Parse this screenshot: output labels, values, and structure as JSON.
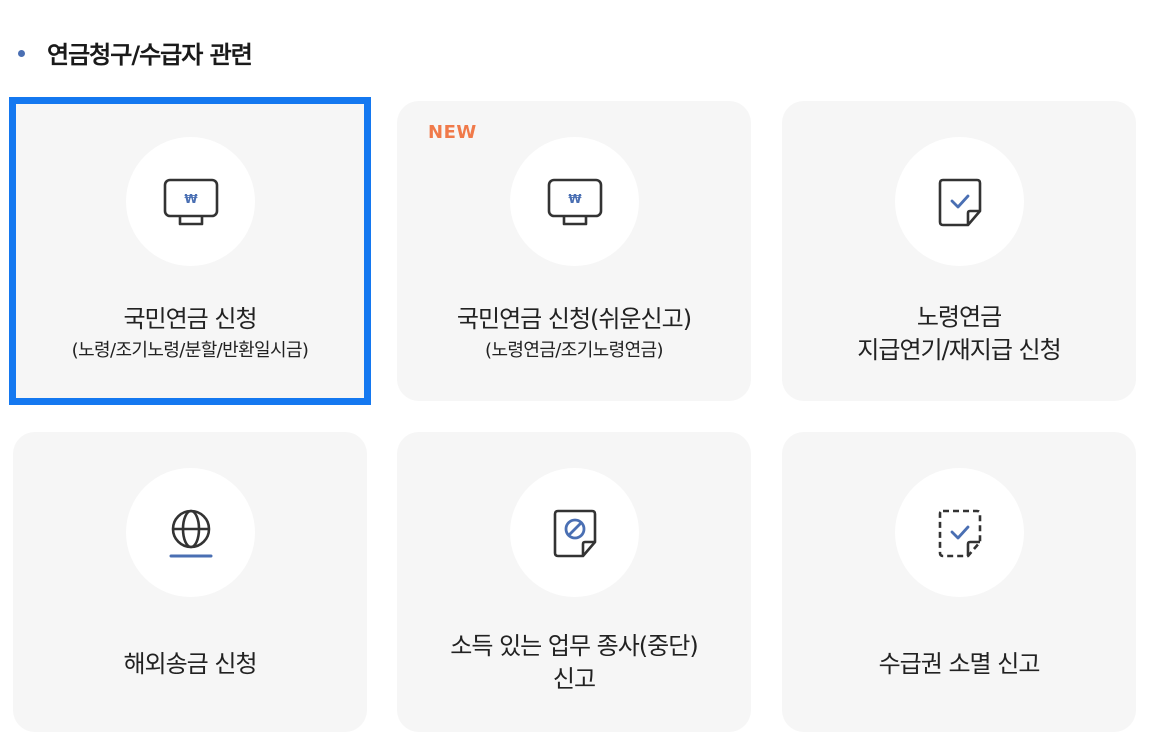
{
  "section": {
    "title": "연금청구/수급자 관련"
  },
  "colors": {
    "accent_blue": "#1478f0",
    "bullet": "#4a6fb3",
    "icon_blue": "#4a6fb3",
    "new_badge": "#f07a4a",
    "card_bg": "#f6f6f6"
  },
  "cards": [
    {
      "icon": "monitor-won-icon",
      "title": "국민연금 신청",
      "subtitle": "(노령/조기노령/분할/반환일시금)",
      "selected": true
    },
    {
      "icon": "monitor-won-icon",
      "badge": "NEW",
      "title": "국민연금 신청(쉬운신고)",
      "subtitle": "(노령연금/조기노령연금)"
    },
    {
      "icon": "document-check-icon",
      "title": "노령연금",
      "title2": "지급연기/재지급 신청"
    },
    {
      "icon": "globe-icon",
      "title": "해외송금 신청"
    },
    {
      "icon": "document-prohibit-icon",
      "title": "소득 있는 업무 종사(중단)",
      "title2": "신고"
    },
    {
      "icon": "document-dashed-check-icon",
      "title": "수급권 소멸 신고"
    }
  ]
}
